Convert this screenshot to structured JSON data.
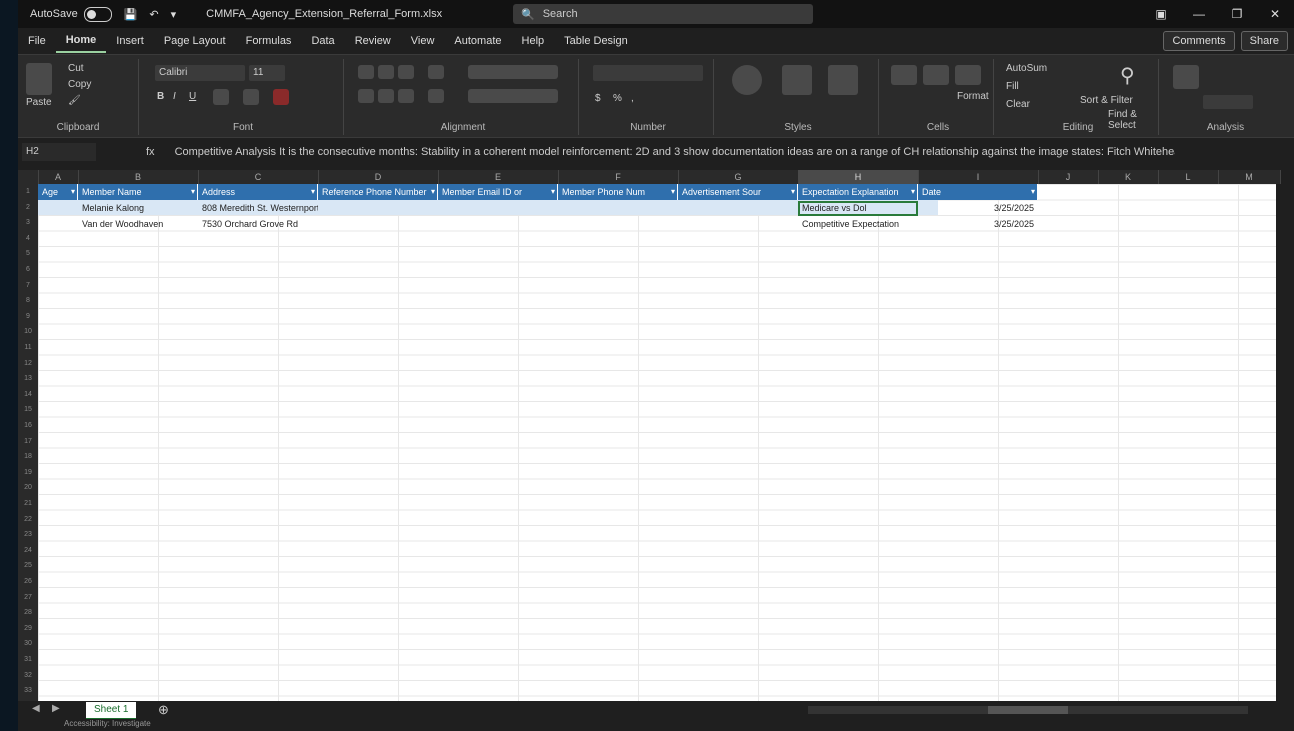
{
  "titlebar": {
    "autosave_label": "AutoSave",
    "autosave_state": "On",
    "filename": "CMMFA_Agency_Extension_Referral_Form.xlsx",
    "search_placeholder": "Search",
    "window_controls": [
      "—",
      "❐",
      "✕"
    ]
  },
  "menu": {
    "tabs": [
      "File",
      "Home",
      "Insert",
      "Page Layout",
      "Formulas",
      "Data",
      "Review",
      "View",
      "Automate",
      "Help",
      "Table Design"
    ],
    "active_tab": "Home",
    "comments_label": "Comments",
    "share_label": "Share"
  },
  "ribbon": {
    "groups": [
      "Clipboard",
      "Font",
      "Alignment",
      "Number",
      "Styles",
      "Cells",
      "Editing",
      "Analysis"
    ],
    "paste_label": "Paste",
    "cut_label": "Cut",
    "copy_label": "Copy",
    "font_name": "Calibri",
    "font_size": "11",
    "autosum_label": "AutoSum",
    "fill_label": "Fill",
    "clear_label": "Clear",
    "sort_filter_label": "Sort & Filter",
    "find_select_label": "Find & Select",
    "format_label": "Format"
  },
  "formula_bar": {
    "name_box": "H2",
    "fx": "fx",
    "content": "Competitive Analysis  It is the consecutive months: Stability in a coherent model reinforcement: 2D and 3 show documentation ideas are on a range of CH relationship against the image states: Fitch Whitehead is a NB"
  },
  "columns": [
    "A",
    "B",
    "C",
    "D",
    "E",
    "F",
    "G",
    "H",
    "I",
    "J",
    "K",
    "L",
    "M"
  ],
  "selected_column": "H",
  "row_numbers": [
    "1",
    "2",
    "3",
    "4",
    "5",
    "6",
    "7",
    "8",
    "9",
    "10",
    "11",
    "12",
    "13",
    "14",
    "15",
    "16",
    "17",
    "18",
    "19",
    "20",
    "21",
    "22",
    "23",
    "24",
    "25",
    "26",
    "27",
    "28",
    "29",
    "30",
    "31",
    "32",
    "33"
  ],
  "table": {
    "headers": [
      "Age",
      "Member Name",
      "Address",
      "Reference Phone Number",
      "Member Email ID or",
      "Member Phone Num",
      "Advertisement Sour",
      "Expectation Explanation",
      "Date"
    ],
    "rows": [
      [
        "",
        "Melanie Kalong",
        "808 Meredith St. Westernport",
        "",
        "",
        "",
        "",
        "Medicare vs Dol",
        "3/25/2025"
      ],
      [
        "",
        "Van der Woodhaven",
        "7530 Orchard Grove Rd",
        "",
        "",
        "",
        "",
        "Competitive Expectation",
        "3/25/2025"
      ]
    ]
  },
  "sheet_tabs": [
    "Sheet 1"
  ],
  "status": {
    "text": "Accessibility: Investigate"
  }
}
